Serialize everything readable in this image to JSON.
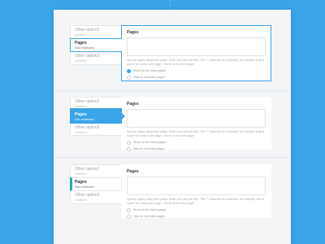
{
  "section_1": {
    "tabs": [
      {
        "title": "Other option2",
        "subtitle": "sustitled"
      },
      {
        "title": "Pages",
        "subtitle": "Not restricted"
      },
      {
        "title": "Other option3",
        "subtitle": "sustitled"
      }
    ],
    "panel": {
      "title": "Pages",
      "help": "Specify pages using their paths. Enter one path per line. The '*' character is a wildcard. An example path is /user/* for every user page. <front> is the front page.",
      "options": [
        "Show for the listed pages",
        "Hide for the listed pages"
      ],
      "selected_option": 0
    }
  },
  "section_2": {
    "tabs": [
      {
        "title": "Other option2",
        "subtitle": "sustitled"
      },
      {
        "title": "Pages",
        "subtitle": "Not restricted"
      },
      {
        "title": "Other option3",
        "subtitle": "sustitled"
      }
    ],
    "panel": {
      "title": "Pages",
      "help": "Specify pages using their paths. Enter one path per line. The '*' character is a wildcard. An example path is /user/* for every user page. <front> is the front page.",
      "options": [
        "Show for the listed pages",
        "Hide for the listed pages"
      ],
      "selected_option": null
    }
  },
  "section_3": {
    "tabs": [
      {
        "title": "Other option2",
        "subtitle": "sustitled"
      },
      {
        "title": "Pages",
        "subtitle": "Not restricted"
      },
      {
        "title": "Other option3",
        "subtitle": "sustitled"
      }
    ],
    "panel": {
      "title": "Pages",
      "help": "Specify pages using their paths. Enter one path per line. The '*' character is a wildcard. An example path is /user/* for every user page. <front> is the front page.",
      "options": [
        "Show for the listed pages",
        "Hide for the listed pages"
      ],
      "selected_option": null
    }
  },
  "colors": {
    "background": "#3aa4e8",
    "accent": "#3aa4e8",
    "accent_bar": "#2aa7b8",
    "sheet": "#f4f5f7"
  }
}
